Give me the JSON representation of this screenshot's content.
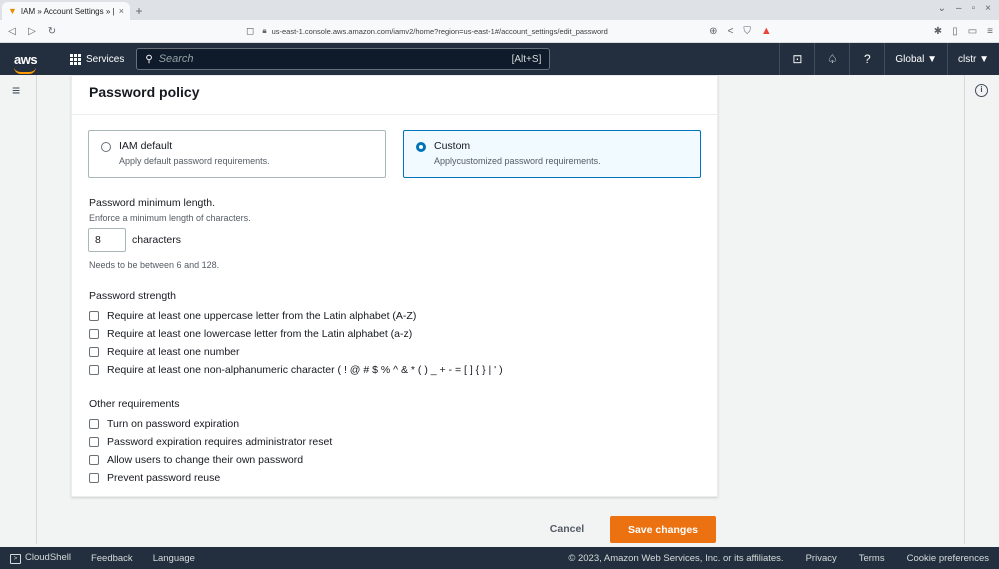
{
  "browser": {
    "tab_title": "IAM » Account Settings » |",
    "new_tab_symbol": "+",
    "url": "us-east-1.console.aws.amazon.com/iamv2/home?region=us-east-1#/account_settings/edit_password"
  },
  "awsnav": {
    "logo": "aws",
    "services_label": "Services",
    "search_placeholder": "Search",
    "search_shortcut": "[Alt+S]",
    "region": "Global ▼",
    "account": "clstr ▼"
  },
  "panel": {
    "title": "Password policy",
    "options": [
      {
        "label": "IAM default",
        "description": "Apply default password requirements.",
        "selected": false
      },
      {
        "label": "Custom",
        "description": "Applycustomized password requirements.",
        "selected": true
      }
    ],
    "min_length": {
      "label": "Password minimum length.",
      "description": "Enforce a minimum length of characters.",
      "value": "8",
      "unit": "characters",
      "hint": "Needs to be between 6 and 128."
    },
    "strength": {
      "label": "Password strength",
      "items": [
        "Require at least one uppercase letter from the Latin alphabet (A-Z)",
        "Require at least one lowercase letter from the Latin alphabet (a-z)",
        "Require at least one number",
        "Require at least one non-alphanumeric character ( ! @ # $ % ^ & * ( ) _ + - = [ ] { } | ' )"
      ]
    },
    "other": {
      "label": "Other requirements",
      "items": [
        "Turn on password expiration",
        "Password expiration requires administrator reset",
        "Allow users to change their own password",
        "Prevent password reuse"
      ]
    }
  },
  "actions": {
    "cancel": "Cancel",
    "save": "Save changes"
  },
  "footer": {
    "cloudshell": "CloudShell",
    "feedback": "Feedback",
    "language": "Language",
    "copyright": "© 2023, Amazon Web Services, Inc. or its affiliates.",
    "privacy": "Privacy",
    "terms": "Terms",
    "cookie": "Cookie preferences"
  },
  "colors": {
    "nav_bg": "#232f3e",
    "accent_orange": "#ec7211",
    "selected_blue": "#0073bb"
  }
}
